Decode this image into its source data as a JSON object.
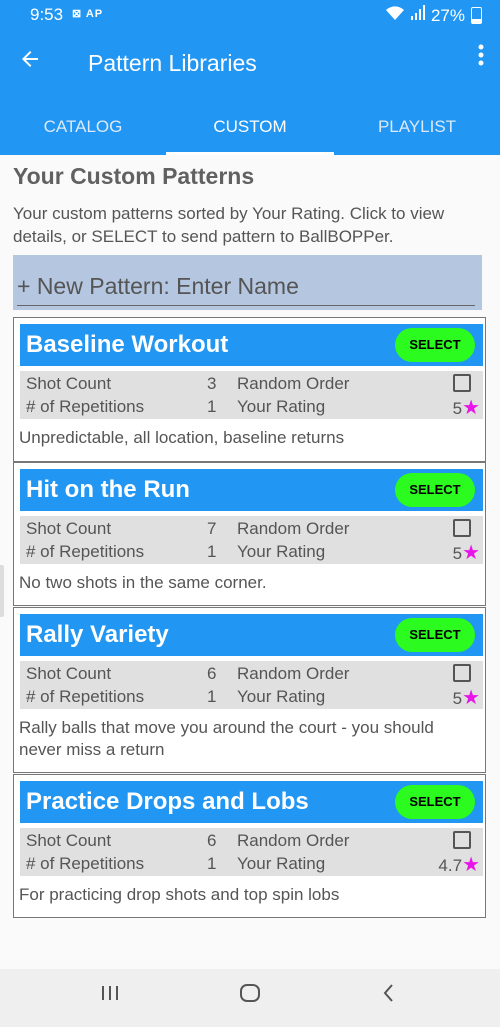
{
  "status": {
    "time": "9:53",
    "icons": "⊠ AP",
    "battery": "27%"
  },
  "appbar": {
    "title": "Pattern Libraries"
  },
  "tabs": [
    {
      "label": "CATALOG"
    },
    {
      "label": "CUSTOM"
    },
    {
      "label": "PLAYLIST"
    }
  ],
  "page": {
    "heading": "Your Custom Patterns",
    "subtitle": "Your custom patterns sorted by Your Rating. Click to view details, or SELECT to send  pattern to BallBOPPer.",
    "new_pattern_placeholder": "+ New Pattern: Enter Name"
  },
  "labels": {
    "shot_count": "Shot Count",
    "repetitions": "# of Repetitions",
    "random_order": "Random Order",
    "your_rating": "Your Rating",
    "select": "SELECT"
  },
  "patterns": [
    {
      "name": "Baseline Workout",
      "shot_count": "3",
      "repetitions": "1",
      "random_order": false,
      "rating": "5",
      "description": "Unpredictable, all location, baseline returns"
    },
    {
      "name": "Hit on the Run",
      "shot_count": "7",
      "repetitions": "1",
      "random_order": false,
      "rating": "5",
      "description": "No two shots in the same corner."
    },
    {
      "name": "Rally Variety",
      "shot_count": "6",
      "repetitions": "1",
      "random_order": false,
      "rating": "5",
      "description": "Rally balls that move you around the court - you should never miss a return"
    },
    {
      "name": "Practice Drops and Lobs",
      "shot_count": "6",
      "repetitions": "1",
      "random_order": false,
      "rating": "4.7",
      "description": "For practicing drop shots and top spin lobs"
    }
  ],
  "colors": {
    "primary": "#2196f3",
    "select_button": "#2bfb1f",
    "star": "#e815e8",
    "input_bg": "#b4c6e0"
  },
  "icons": {
    "back": "arrow-back-icon",
    "more": "more-vertical-icon",
    "star": "star-icon",
    "nav_recents": "recents-icon",
    "nav_home": "home-icon",
    "nav_back": "nav-back-icon"
  }
}
